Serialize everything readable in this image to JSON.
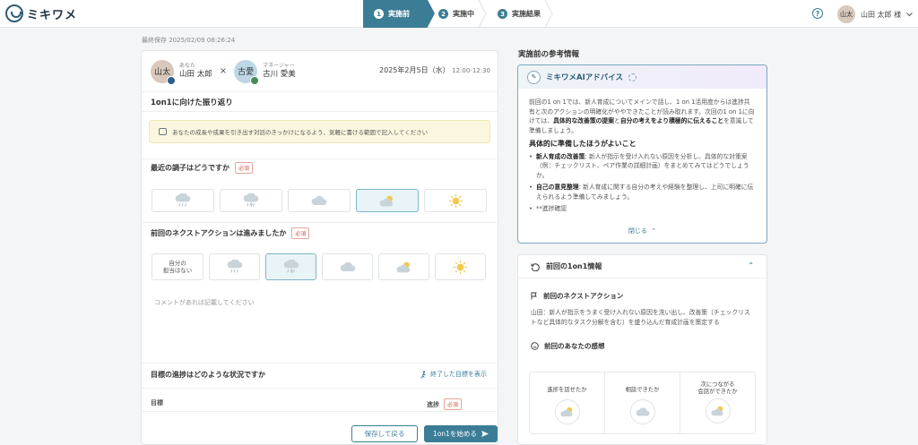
{
  "app": {
    "name": "ミキワメ"
  },
  "steps": [
    {
      "num": "1",
      "label": "実施前"
    },
    {
      "num": "2",
      "label": "実施中"
    },
    {
      "num": "3",
      "label": "実施結果"
    }
  ],
  "user": {
    "avatar": "山太",
    "name": "山田 太郎 様"
  },
  "saved": "最終保存 2025/02/09 08:26:24",
  "session": {
    "me": {
      "role": "あなた",
      "name": "山田 太郎",
      "avatar": "山太"
    },
    "times": "×",
    "manager": {
      "role": "マネージャー",
      "name": "古川 愛美",
      "avatar": "古愛"
    },
    "date": "2025年2月5日（水）",
    "time": "12:00-12:30"
  },
  "reflection": {
    "title": "1on1に向けた振り返り",
    "hint": "あなたの成長や成果を引き出す対話のきっかけになるよう、気軽に書ける範囲で記入してください",
    "q1": "最近の調子はどうですか",
    "q2": "前回のネクストアクションは進みましたか",
    "required": "必須",
    "not_mine_1": "自分の",
    "not_mine_2": "担当はない",
    "comment_placeholder": "コメントがあれば記載してください",
    "goal_q": "目標の進捗はどのような状況ですか",
    "goal_link": "終了した目標を表示",
    "col_goal": "目標",
    "col_progress": "進捗"
  },
  "buttons": {
    "save": "保存して戻る",
    "start": "1on1を始める"
  },
  "ref": {
    "title": "実施前の参考情報",
    "ai_title": "ミキワメAIアドバイス",
    "p1": "前回の1 on 1では、新人育成についてメインで話し、1 on 1活用度から",
    "p2": "は進捗共有と次のアクションの明確化がややできたことが読み取れ",
    "p3a": "ます。次回の1 on 1に向けては、",
    "p3b": "具体的な改善策の提案",
    "p3c": "と",
    "p3d": "自分の考え",
    "p4a": "をより積極的に伝えること",
    "p4b": "を意識して準備しましょう。",
    "h": "具体的に準備したほうがよいこと",
    "b1a": "新人育成の改善策",
    "b1b": ": 新人が指示を受け入れない原因を分析し、具体的な対策案（例：チェックリスト、ペア作業の詳細計画）をまとめてみてはどうでしょうか。",
    "b2a": "自己の意見整理",
    "b2b": ": 新人育成に関する自分の考えや経験を整理し、上司に明確に伝えられるよう準備してみましょう。",
    "b3": "**進捗確認",
    "close": "閉じる"
  },
  "prev": {
    "title": "前回の1on1情報",
    "na_label": "前回のネクストアクション",
    "na_text": "山田：新人が指示をうまく受け入れない原因を洗い出し、改善策（チェックリストなど具体的なタスク分解を含む）を盛り込んだ育成計画を策定する",
    "feel_label": "前回のあなたの感想",
    "f1": "進捗を話せたか",
    "f2": "相談できたか",
    "f3a": "次につながる",
    "f3b": "会話ができたか"
  },
  "colors": {
    "accent": "#3b7d95",
    "required": "#d05a4c"
  }
}
